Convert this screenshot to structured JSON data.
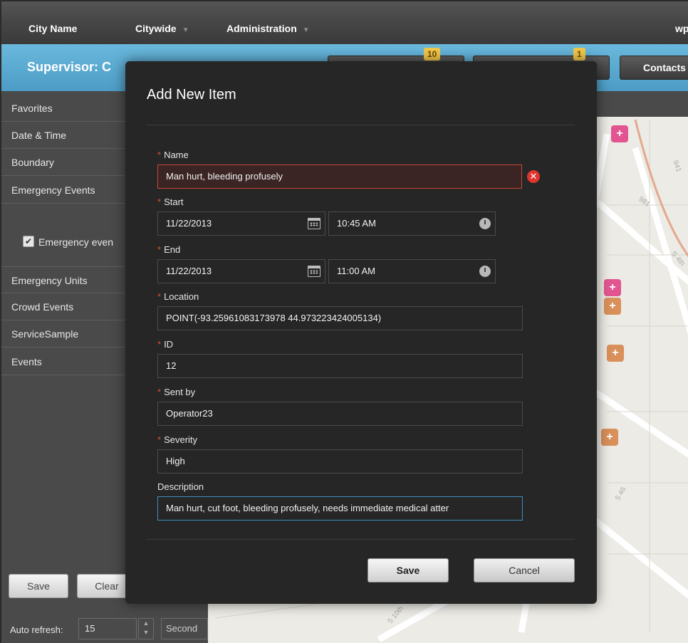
{
  "topnav": {
    "city_name": "City Name",
    "citywide": "Citywide",
    "administration": "Administration",
    "user": "wp"
  },
  "header": {
    "title": "Supervisor: C",
    "buttons": [
      {
        "label": "",
        "badge": "10"
      },
      {
        "label": "",
        "badge": "1"
      },
      {
        "label": "Contacts"
      }
    ]
  },
  "sidebar": {
    "items": [
      "Favorites",
      "Date & Time",
      "Boundary",
      "Emergency Events",
      "Emergency Units",
      "Crowd Events",
      "ServiceSample",
      "Events"
    ],
    "checkbox_label": "Emergency even",
    "checkbox_checked": true,
    "save_label": "Save",
    "clear_label": "Clear",
    "auto_refresh_label": "Auto refresh:",
    "auto_refresh_value": "15",
    "auto_refresh_unit": "Second"
  },
  "map": {
    "road_labels": [
      "941",
      "981",
      "S 4th",
      "5 10th",
      "5 46"
    ]
  },
  "modal": {
    "title": "Add New Item",
    "fields": {
      "name": {
        "label": "Name",
        "value": "Man hurt, bleeding profusely"
      },
      "start": {
        "label": "Start",
        "date": "11/22/2013",
        "time": "10:45 AM"
      },
      "end": {
        "label": "End",
        "date": "11/22/2013",
        "time": "11:00 AM"
      },
      "location": {
        "label": "Location",
        "value": "POINT(-93.25961083173978 44.973223424005134)"
      },
      "id": {
        "label": "ID",
        "value": "12"
      },
      "sent_by": {
        "label": "Sent by",
        "value": "Operator23"
      },
      "severity": {
        "label": "Severity",
        "value": "High"
      },
      "description": {
        "label": "Description",
        "value": "Man hurt, cut foot, bleeding profusely, needs immediate medical atter"
      }
    },
    "save_label": "Save",
    "cancel_label": "Cancel"
  },
  "colors": {
    "accent_blue": "#4c9cc6",
    "modal_bg": "#262626",
    "required_asterisk": "#d35232",
    "error_red": "#e0352e",
    "badge_yellow": "#f2c74a"
  }
}
